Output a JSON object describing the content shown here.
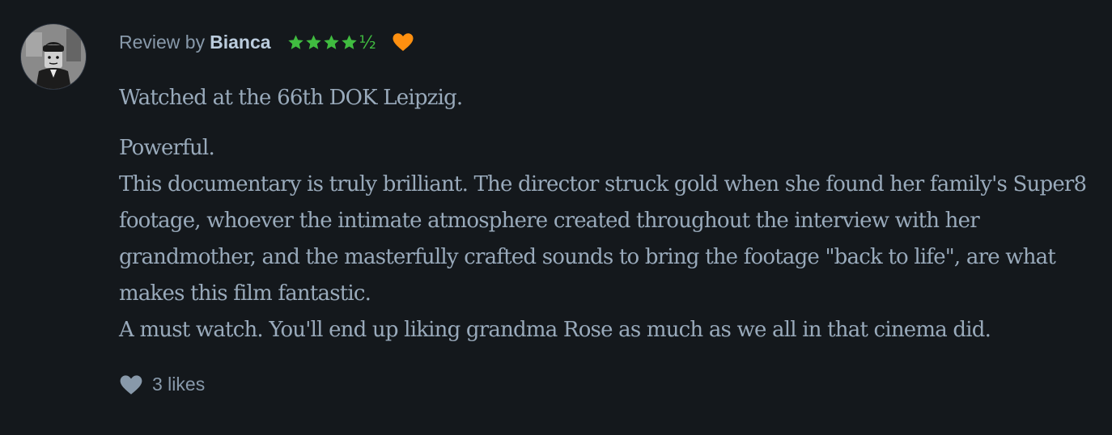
{
  "review": {
    "prefix": "Review by",
    "username": "Bianca",
    "rating_stars": 4.5,
    "rating_half_glyph": "½",
    "liked": true,
    "paragraphs": [
      "Watched at the 66th DOK Leipzig.",
      "Powerful.\nThis documentary is truly brilliant. The director struck gold when she found her family's Super8 footage, whoever the intimate atmosphere created throughout the interview with her grandmother, and the masterfully crafted sounds to bring the footage \"back to life\", are what makes this film fantastic.\nA must watch. You'll end up liking grandma Rose as much as we all in that cinema did."
    ]
  },
  "likes": {
    "label": "3 likes",
    "icon": "heart-icon"
  },
  "colors": {
    "background": "#14181c",
    "text": "#99aabb",
    "username": "#bbccdd",
    "star_green": "#40bc40",
    "liked_orange": "#ff9010",
    "muted_heart": "#8899aa"
  }
}
